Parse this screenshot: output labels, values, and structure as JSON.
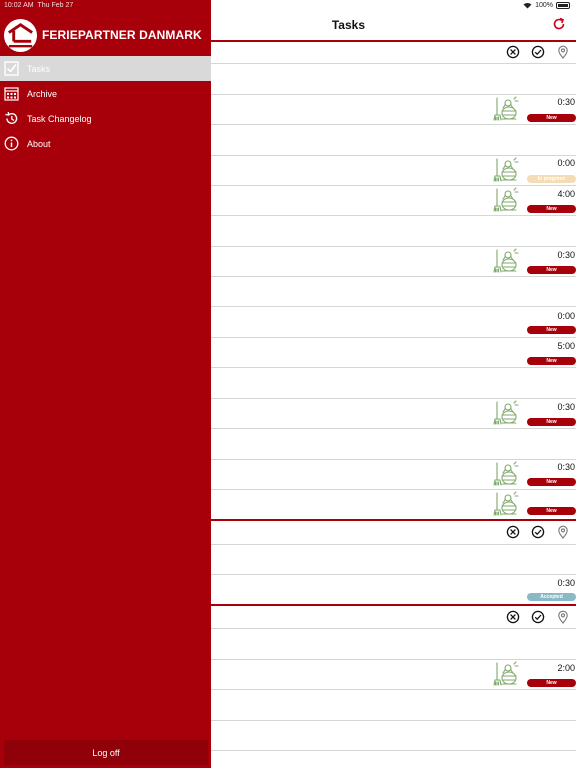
{
  "status_bar": {
    "time": "10:02 AM",
    "date": "Thu Feb 27",
    "battery": "100%"
  },
  "sidebar": {
    "brand": "FERIEPARTNER DANMARK",
    "items": [
      {
        "label": "Tasks",
        "icon": "checkbox-icon",
        "active": true
      },
      {
        "label": "Archive",
        "icon": "calendar-icon",
        "active": false
      },
      {
        "label": "Task Changelog",
        "icon": "history-icon",
        "active": false
      },
      {
        "label": "About",
        "icon": "info-icon",
        "active": false
      }
    ],
    "logoff_label": "Log off"
  },
  "header": {
    "title": "Tasks",
    "refresh_icon": "refresh-icon"
  },
  "tasks": [
    {
      "time": "0:30",
      "status": "New",
      "cleaning": true
    },
    {
      "time": "0:00",
      "status": "In progress",
      "cleaning": true
    },
    {
      "time": "4:00",
      "status": "New",
      "cleaning": true
    },
    {
      "time": "0:30",
      "status": "New",
      "cleaning": true
    },
    {
      "time": "0:00",
      "status": "New",
      "cleaning": false
    },
    {
      "time": "5:00",
      "status": "New",
      "cleaning": false
    },
    {
      "time": "0:30",
      "status": "New",
      "cleaning": true
    },
    {
      "time": "0:30",
      "status": "New",
      "cleaning": true
    },
    {
      "time": "",
      "status": "New",
      "cleaning": true
    },
    {
      "time": "0:30",
      "status": "Accepted",
      "cleaning": false
    },
    {
      "time": "2:00",
      "status": "New",
      "cleaning": true
    }
  ],
  "colors": {
    "brand_red": "#a8000b",
    "badge_new": "#a8000b",
    "badge_in_progress": "#f5dcb6",
    "badge_accepted": "#89b9c4",
    "cleaning_icon": "#7ea86a"
  }
}
